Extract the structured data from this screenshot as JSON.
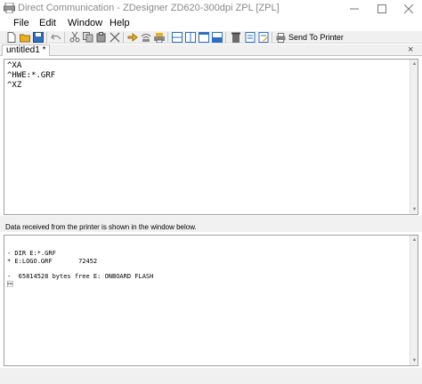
{
  "window": {
    "title": "Direct Communication - ZDesigner ZD620-300dpi ZPL [ZPL]",
    "minimize_glyph": "—",
    "maximize_glyph": "☐",
    "close_glyph": "✕"
  },
  "menu": [
    {
      "label": "File"
    },
    {
      "label": "Edit"
    },
    {
      "label": "Window"
    },
    {
      "label": "Help"
    }
  ],
  "toolbar": {
    "send_label": "Send To Printer",
    "icons": [
      "new-file-icon",
      "open-folder-icon",
      "save-icon",
      "undo-icon",
      "cut-icon",
      "copy-icon",
      "paste-icon",
      "delete-icon",
      "upload-icon",
      "wireless-icon",
      "print-settings-icon",
      "layout-horizontal-icon",
      "layout-vertical-icon",
      "layout-single-icon",
      "layout-split-icon",
      "clear-icon",
      "book-icon",
      "book-edit-icon",
      "send-to-printer-icon"
    ]
  },
  "tab": {
    "label": "untitled1 *",
    "close_glyph": "×"
  },
  "editor": {
    "lines": [
      "^XA",
      "^HWE:*.GRF",
      "^XZ"
    ]
  },
  "info": {
    "text": "Data received from the printer is shown in the window below."
  },
  "response": {
    "lines": [
      "",
      "- DIR E:*.GRF",
      "* E:LOGO.GRF       72452",
      "",
      "-  65814528 bytes free E: ONBOARD FLASH",
      "\u0002"
    ]
  },
  "colors": {
    "chrome_bg": "#f0f0f0",
    "border": "#a0a0a0",
    "title_text": "#8a8a8a",
    "icon_blue": "#2f6fc0",
    "icon_yellow": "#e8b020",
    "icon_gray": "#6b6b6b"
  }
}
